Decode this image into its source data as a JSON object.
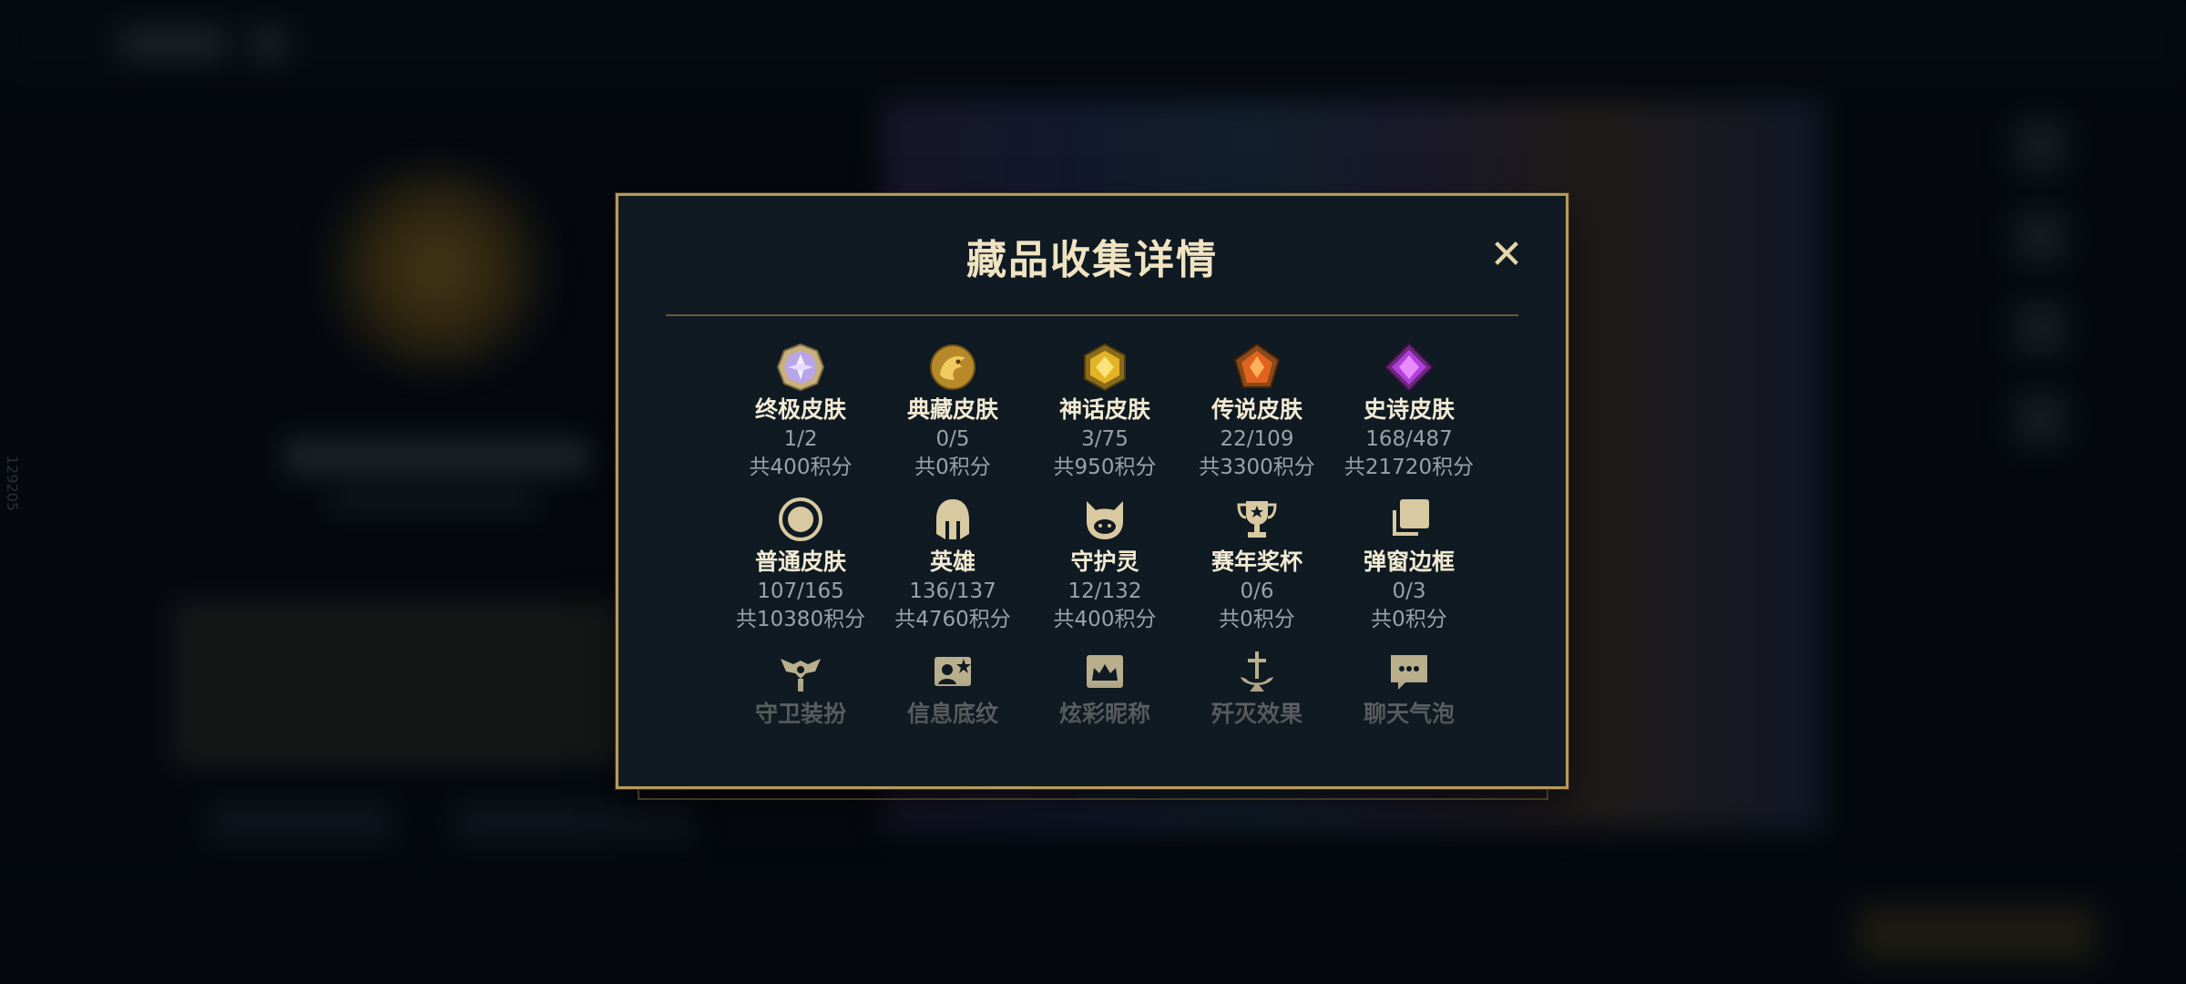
{
  "background": {
    "side_label": "129205"
  },
  "dialog": {
    "title": "藏品收集详情",
    "close_label": "✕",
    "rows": [
      [
        {
          "name": "终极皮肤",
          "count": "1/2",
          "points": "共400积分",
          "icon": "ultimate-skin-gem-icon"
        },
        {
          "name": "典藏皮肤",
          "count": "0/5",
          "points": "共0积分",
          "icon": "prestige-skin-dragon-icon"
        },
        {
          "name": "神话皮肤",
          "count": "3/75",
          "points": "共950积分",
          "icon": "mythic-skin-gem-icon"
        },
        {
          "name": "传说皮肤",
          "count": "22/109",
          "points": "共3300积分",
          "icon": "legendary-skin-gem-icon"
        },
        {
          "name": "史诗皮肤",
          "count": "168/487",
          "points": "共21720积分",
          "icon": "epic-skin-gem-icon"
        }
      ],
      [
        {
          "name": "普通皮肤",
          "count": "107/165",
          "points": "共10380积分",
          "icon": "normal-skin-ring-icon"
        },
        {
          "name": "英雄",
          "count": "136/137",
          "points": "共4760积分",
          "icon": "champion-helmet-icon"
        },
        {
          "name": "守护灵",
          "count": "12/132",
          "points": "共400积分",
          "icon": "guardian-spirit-icon"
        },
        {
          "name": "赛年奖杯",
          "count": "0/6",
          "points": "共0积分",
          "icon": "trophy-icon"
        },
        {
          "name": "弹窗边框",
          "count": "0/3",
          "points": "共0积分",
          "icon": "popup-frame-icon"
        }
      ],
      [
        {
          "name": "守卫装扮",
          "icon": "ward-skin-icon"
        },
        {
          "name": "信息底纹",
          "icon": "info-card-icon"
        },
        {
          "name": "炫彩昵称",
          "icon": "colorful-nickname-icon"
        },
        {
          "name": "歼灭效果",
          "icon": "annihilation-effect-icon"
        },
        {
          "name": "聊天气泡",
          "icon": "chat-bubble-icon"
        }
      ]
    ]
  },
  "colors": {
    "gold_border": "#b79a5b",
    "dialog_bg": "#0f1a22",
    "title_text": "#efe3c2",
    "muted_text": "#9aa2a8"
  }
}
